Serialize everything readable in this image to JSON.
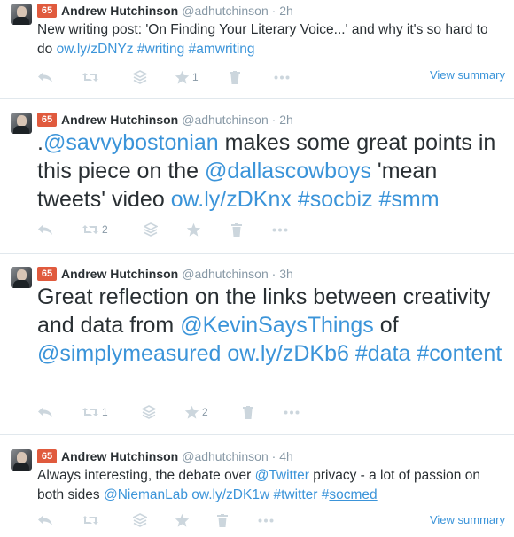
{
  "tweets": [
    {
      "avatar_badge": "65",
      "name": "Andrew Hutchinson",
      "handle": "@adhutchinson",
      "separator": "·",
      "time": "2h",
      "segments": [
        {
          "t": "New writing post: 'On Finding Your Literary Voice...' and why it's so hard to do ",
          "k": "text"
        },
        {
          "t": "ow.ly/zDNYz",
          "k": "link"
        },
        {
          "t": " ",
          "k": "text"
        },
        {
          "t": "#writing",
          "k": "link"
        },
        {
          "t": " ",
          "k": "text"
        },
        {
          "t": "#amwriting",
          "k": "link"
        }
      ],
      "retweet_count": "",
      "favorite_count": "1",
      "summary_label": "View summary"
    },
    {
      "avatar_badge": "65",
      "name": "Andrew Hutchinson",
      "handle": "@adhutchinson",
      "separator": "·",
      "time": "2h",
      "segments": [
        {
          "t": ".",
          "k": "text"
        },
        {
          "t": "@savvybostonian",
          "k": "link"
        },
        {
          "t": " makes some great points in this piece on the ",
          "k": "text"
        },
        {
          "t": "@dallascowboys",
          "k": "link"
        },
        {
          "t": " 'mean tweets' video ",
          "k": "text"
        },
        {
          "t": "ow.ly/zDKnx",
          "k": "link"
        },
        {
          "t": " ",
          "k": "text"
        },
        {
          "t": "#socbiz",
          "k": "link"
        },
        {
          "t": " ",
          "k": "text"
        },
        {
          "t": "#smm",
          "k": "link"
        }
      ],
      "retweet_count": "2",
      "favorite_count": "",
      "summary_label": ""
    },
    {
      "avatar_badge": "65",
      "name": "Andrew Hutchinson",
      "handle": "@adhutchinson",
      "separator": "·",
      "time": "3h",
      "segments": [
        {
          "t": "Great reflection on the links between creativity and data from ",
          "k": "text"
        },
        {
          "t": "@KevinSaysThings",
          "k": "link"
        },
        {
          "t": " of ",
          "k": "text"
        },
        {
          "t": "@simplymeasured",
          "k": "link"
        },
        {
          "t": " ",
          "k": "text"
        },
        {
          "t": "ow.ly/zDKb6",
          "k": "link"
        },
        {
          "t": " ",
          "k": "text"
        },
        {
          "t": "#data",
          "k": "link"
        },
        {
          "t": " ",
          "k": "text"
        },
        {
          "t": "#content",
          "k": "link"
        }
      ],
      "retweet_count": "1",
      "favorite_count": "2",
      "summary_label": ""
    },
    {
      "avatar_badge": "65",
      "name": "Andrew Hutchinson",
      "handle": "@adhutchinson",
      "separator": "·",
      "time": "4h",
      "segments": [
        {
          "t": "Always interesting, the debate over ",
          "k": "text"
        },
        {
          "t": "@Twitter",
          "k": "link"
        },
        {
          "t": " privacy - a lot of passion on both sides ",
          "k": "text"
        },
        {
          "t": "@NiemanLab",
          "k": "link"
        },
        {
          "t": " ",
          "k": "text"
        },
        {
          "t": "ow.ly/zDK1w",
          "k": "link"
        },
        {
          "t": " ",
          "k": "text"
        },
        {
          "t": "#twitter",
          "k": "link"
        },
        {
          "t": " ",
          "k": "text"
        },
        {
          "t": "#",
          "k": "link"
        },
        {
          "t": "socmed",
          "k": "link-underline"
        }
      ],
      "retweet_count": "",
      "favorite_count": "",
      "summary_label": "View summary"
    }
  ]
}
